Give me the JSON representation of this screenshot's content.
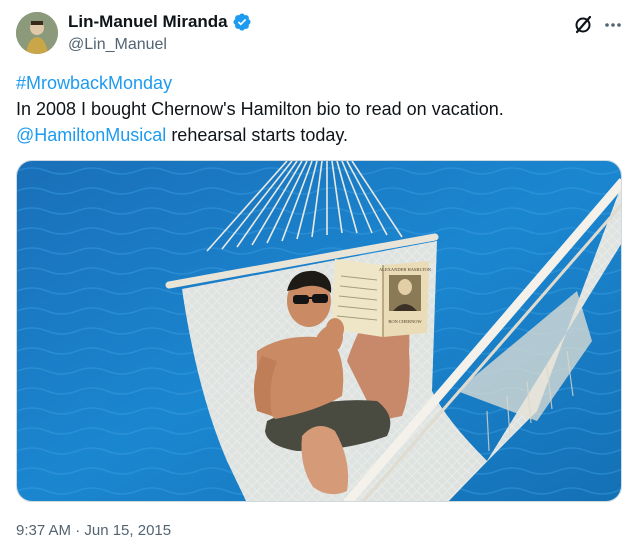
{
  "user": {
    "display_name": "Lin-Manuel Miranda",
    "handle": "@Lin_Manuel",
    "verified": true
  },
  "tweet": {
    "hashtag": "#MrowbackMonday",
    "line1": "In 2008 I bought Chernow's Hamilton bio to read on vacation.",
    "mention": "@HamiltonMusical",
    "line2_rest": " rehearsal starts today.",
    "timestamp": "9:37 AM · Jun 15, 2015"
  },
  "media": {
    "book_title": "ALEXANDER HAMILTON",
    "book_author": "RON CHERNOW"
  },
  "icons": {
    "verified": "verified-badge-icon",
    "grok": "grok-icon",
    "more": "more-icon"
  },
  "colors": {
    "link": "#1d9bf0",
    "verified_badge": "#1d9bf0",
    "secondary_text": "#536471",
    "pool_blue": "#1a78c2"
  }
}
